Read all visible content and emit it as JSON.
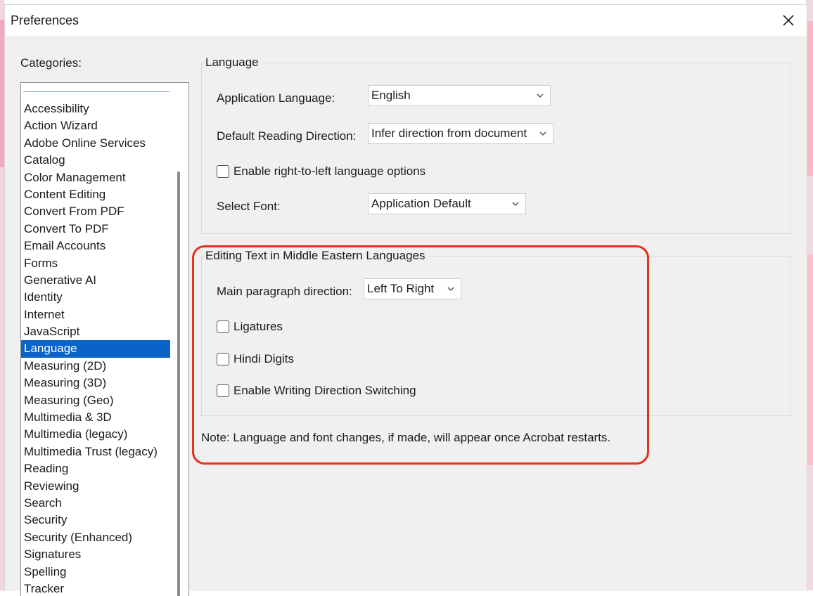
{
  "dialog": {
    "title": "Preferences"
  },
  "categories": {
    "label": "Categories:",
    "items": [
      "Accessibility",
      "Action Wizard",
      "Adobe Online Services",
      "Catalog",
      "Color Management",
      "Content Editing",
      "Convert From PDF",
      "Convert To PDF",
      "Email Accounts",
      "Forms",
      "Generative AI",
      "Identity",
      "Internet",
      "JavaScript",
      "Language",
      "Measuring (2D)",
      "Measuring (3D)",
      "Measuring (Geo)",
      "Multimedia & 3D",
      "Multimedia (legacy)",
      "Multimedia Trust (legacy)",
      "Reading",
      "Reviewing",
      "Search",
      "Security",
      "Security (Enhanced)",
      "Signatures",
      "Spelling",
      "Tracker"
    ],
    "selected": "Language"
  },
  "language_group": {
    "title": "Language",
    "app_language_label": "Application Language:",
    "app_language_value": "English",
    "reading_direction_label": "Default Reading Direction:",
    "reading_direction_value": "Infer direction from document",
    "rtl_checkbox_label": "Enable right-to-left language options",
    "select_font_label": "Select Font:",
    "select_font_value": "Application Default"
  },
  "middle_eastern_group": {
    "title": "Editing Text in Middle Eastern Languages",
    "paragraph_direction_label": "Main paragraph direction:",
    "paragraph_direction_value": "Left To Right",
    "ligatures_label": "Ligatures",
    "hindi_digits_label": "Hindi Digits",
    "writing_direction_label": "Enable Writing Direction Switching"
  },
  "note": "Note: Language and font changes, if made, will appear once Acrobat restarts.",
  "colors": {
    "selection": "#0a64c8",
    "highlight": "#e8301c",
    "dialog_bg": "#f0f0f0"
  },
  "icons": {
    "close": "close-icon",
    "dropdown": "chevron-down-icon"
  }
}
